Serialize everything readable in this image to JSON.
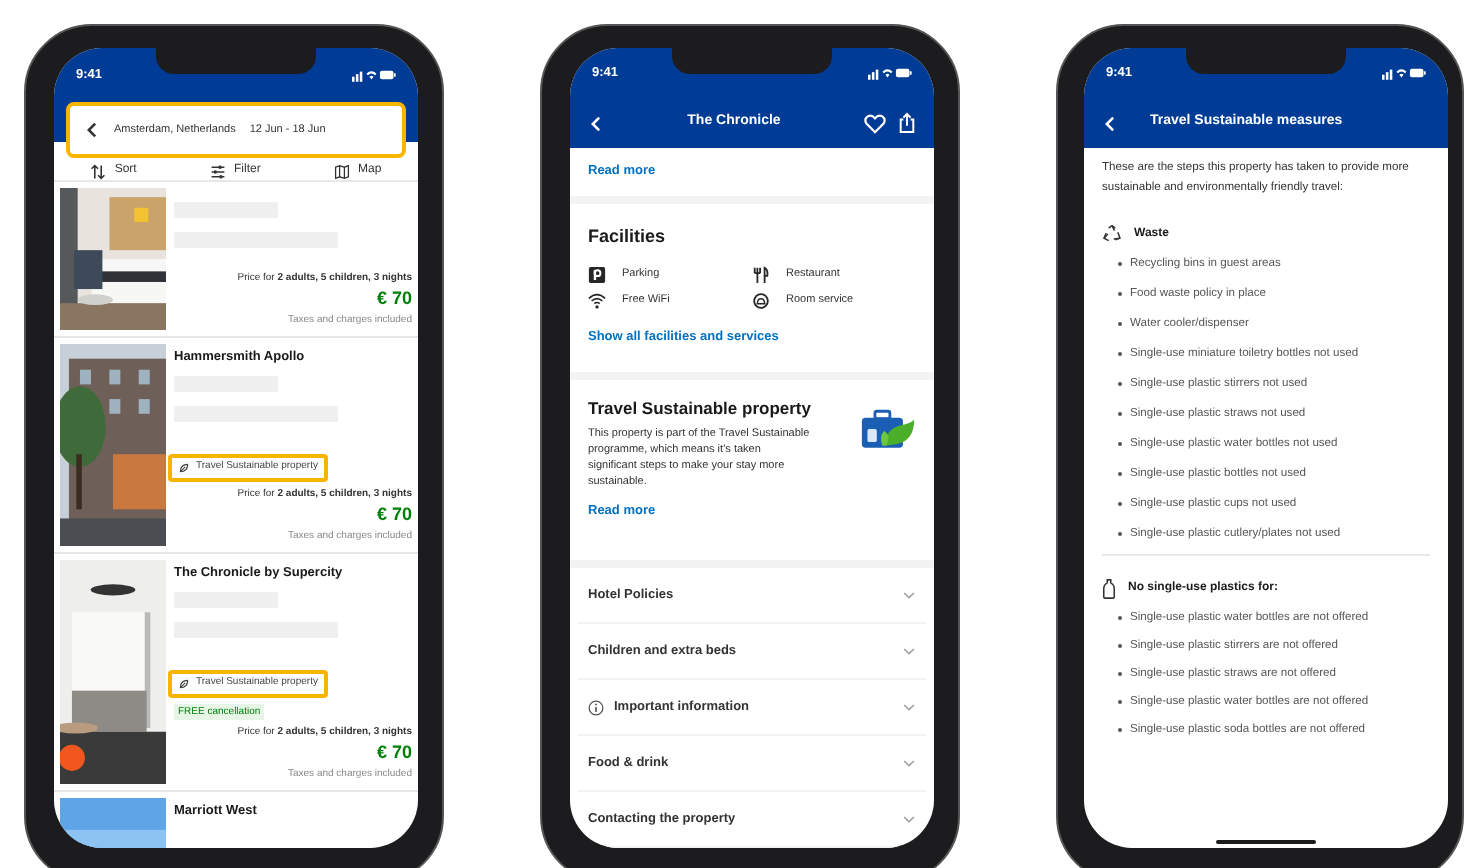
{
  "results_screen": {
    "status_time": "9:41",
    "search": {
      "destination": "Amsterdam, Netherlands",
      "dates": "12 Jun - 18 Jun",
      "highlighted": true
    },
    "toolbar": [
      {
        "label": "Sort",
        "kind": "sort"
      },
      {
        "label": "Filter",
        "kind": "filter"
      },
      {
        "label": "Map",
        "kind": "map"
      }
    ],
    "cards": [
      {
        "price_note": "Price for **2 adults, 5 children, 3 nights**",
        "price": "€ 70",
        "taxes": "Taxes and charges included"
      },
      {
        "name": "Hammersmith Apollo",
        "tag": {
          "label": "Travel Sustainable property",
          "highlighted": true
        },
        "price_note": "Price for **2 adults, 5 children, 3 nights**",
        "price": "€ 70",
        "taxes": "Taxes and charges included"
      },
      {
        "name": "The Chronicle by Supercity",
        "tag": {
          "label": "Travel Sustainable property",
          "highlighted": true
        },
        "free_cancellation": "FREE cancellation",
        "price_note": "Price for **2 adults, 5 children, 3 nights**",
        "price": "€ 70",
        "taxes": "Taxes and charges included"
      },
      {
        "name": "Marriott West"
      }
    ]
  },
  "property_screen": {
    "status_time": "9:41",
    "title": "The Chronicle",
    "read_more": "Read more",
    "facilities": {
      "heading": "Facilities",
      "items": [
        {
          "label": "Parking",
          "kind": "parking"
        },
        {
          "label": "Restaurant",
          "kind": "restaurant"
        },
        {
          "label": "Free WiFi",
          "kind": "wifi"
        },
        {
          "label": "Room service",
          "kind": "room_service"
        }
      ],
      "link": "Show all facilities and services"
    },
    "sustainable": {
      "heading": "Travel Sustainable property",
      "text": "This property is part of the Travel Sustainable programme, which means it’s taken significant steps to make your stay more sustainable.",
      "link": "Read more"
    },
    "sections": [
      {
        "label": "Hotel Policies",
        "kind": "plain"
      },
      {
        "label": "Children and extra beds",
        "kind": "plain"
      },
      {
        "label": "Important information",
        "kind": "info"
      },
      {
        "label": "Food & drink",
        "kind": "plain"
      },
      {
        "label": "Contacting the property",
        "kind": "plain"
      }
    ]
  },
  "measures_screen": {
    "status_time": "9:41",
    "title": "Travel Sustainable measures",
    "intro": "These are the steps this property has taken to provide more sustainable and environmentally friendly travel:",
    "groups": [
      {
        "heading": "Waste",
        "kind": "waste",
        "items": [
          "Recycling bins in guest areas",
          "Food waste policy in place",
          "Water cooler/dispenser",
          "Single-use miniature toiletry bottles not used",
          "Single-use plastic stirrers not used",
          "Single-use plastic straws not used",
          "Single-use plastic water bottles not used",
          "Single-use plastic bottles not used",
          "Single-use plastic cups not used",
          "Single-use plastic cutlery/plates not used"
        ]
      },
      {
        "heading": "No single-use plastics for:",
        "kind": "plastics",
        "items": [
          "Single-use plastic water bottles are not offered",
          "Single-use plastic stirrers are not offered",
          "Single-use plastic straws are not offered",
          "Single-use plastic water bottles are not offered",
          "Single-use plastic soda bottles are not offered"
        ]
      }
    ]
  }
}
